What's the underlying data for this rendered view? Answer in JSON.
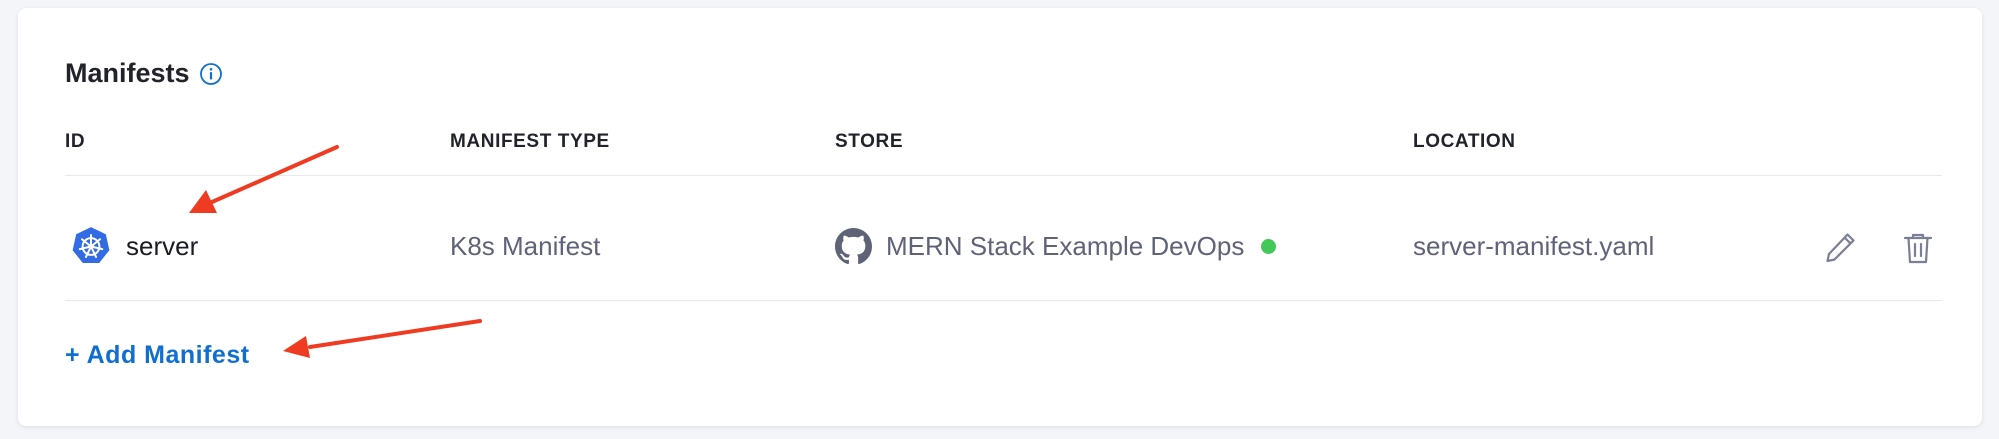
{
  "section": {
    "title": "Manifests",
    "info_icon": "info-circle-icon"
  },
  "table": {
    "columns": [
      "ID",
      "MANIFEST TYPE",
      "STORE",
      "LOCATION"
    ],
    "rows": [
      {
        "id": "server",
        "id_icon": "kubernetes-icon",
        "manifest_type": "K8s Manifest",
        "store": "MERN Stack Example DevOps",
        "store_icon": "github-icon",
        "store_status": "connected",
        "location": "server-manifest.yaml",
        "actions": [
          "edit-icon",
          "trash-icon"
        ]
      }
    ]
  },
  "add_manifest_label": "+ Add Manifest",
  "annotations": {
    "arrows": [
      "points-to-server-id",
      "points-to-add-manifest"
    ]
  },
  "colors": {
    "link": "#0f6fd1",
    "status_ok": "#42c95a",
    "arrow": "#ee3b22",
    "k8s": "#326ce5"
  }
}
